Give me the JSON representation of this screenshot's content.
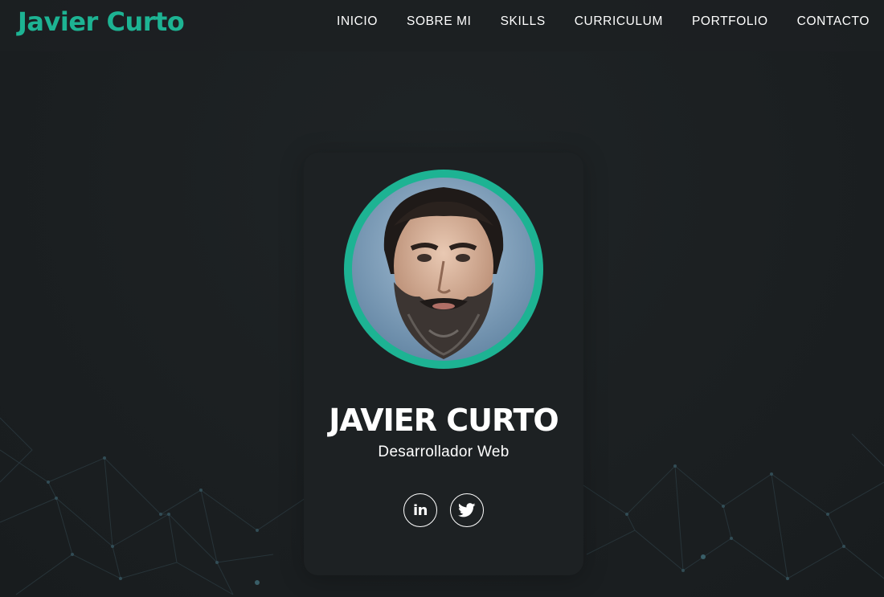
{
  "header": {
    "logo": "Javier Curto",
    "nav": [
      "INICIO",
      "SOBRE MI",
      "SKILLS",
      "CURRICULUM",
      "PORTFOLIO",
      "CONTACTO"
    ]
  },
  "profile": {
    "name": "JAVIER CURTO",
    "role": "Desarrollador Web",
    "socials": [
      {
        "icon": "linkedin-icon",
        "label": "in"
      },
      {
        "icon": "twitter-icon"
      }
    ]
  },
  "colors": {
    "accent": "#1db393",
    "background": "#1c2022",
    "card": "#1d2123",
    "text": "#ffffff"
  }
}
